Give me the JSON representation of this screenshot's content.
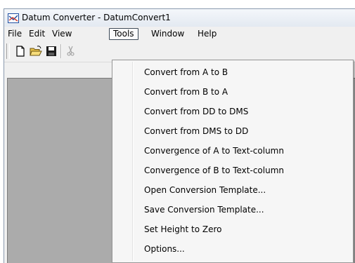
{
  "window": {
    "title": "Datum Converter - DatumConvert1"
  },
  "menubar": {
    "items": [
      {
        "label": "File"
      },
      {
        "label": "Edit"
      },
      {
        "label": "View"
      },
      {
        "label": "Tools",
        "active": true
      },
      {
        "label": "Window"
      },
      {
        "label": "Help"
      }
    ]
  },
  "toolbar": {
    "buttons": [
      {
        "icon": "new-document-icon"
      },
      {
        "icon": "open-folder-icon"
      },
      {
        "icon": "save-disk-icon"
      },
      {
        "icon": "cut-scissors-icon"
      }
    ]
  },
  "tools_menu": {
    "items": [
      {
        "label": "Convert from A to B"
      },
      {
        "label": "Convert from B to A"
      },
      {
        "label": "Convert from DD to DMS"
      },
      {
        "label": "Convert from DMS to DD"
      },
      {
        "label": "Convergence of A to Text-column"
      },
      {
        "label": "Convergence of B to Text-column"
      },
      {
        "label": "Open Conversion Template..."
      },
      {
        "label": "Save Conversion Template..."
      },
      {
        "label": "Set Height to Zero"
      },
      {
        "label": "Options..."
      }
    ]
  },
  "colors": {
    "workspace": "#ababab",
    "menu_background": "#f6f6f6",
    "chrome": "#f0f0f0"
  }
}
